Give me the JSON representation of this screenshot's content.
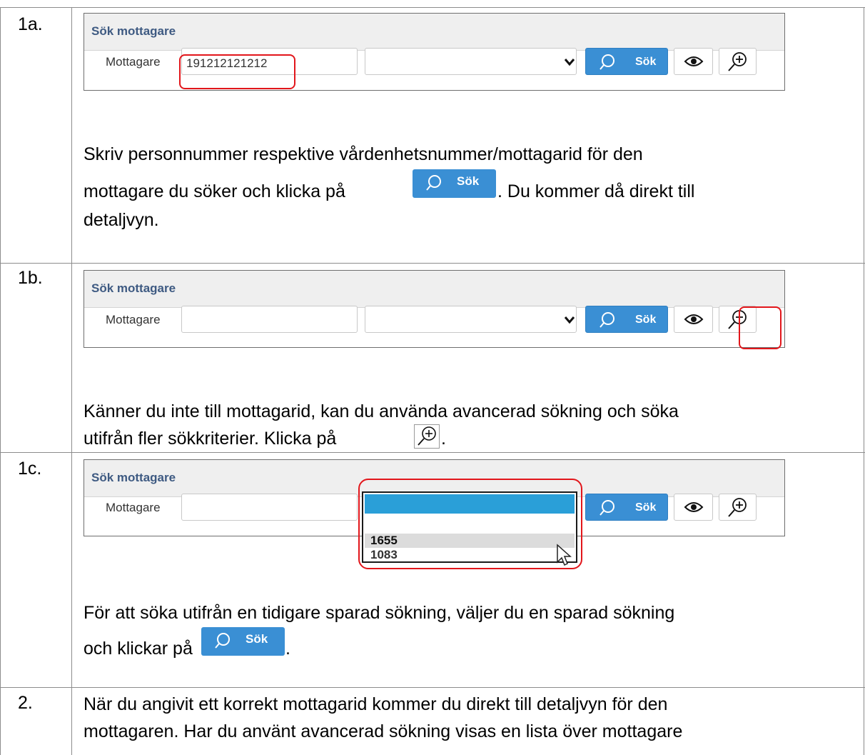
{
  "widget": {
    "title": "Sök mottagare",
    "label": "Mottagare",
    "search_label": "Sök"
  },
  "steps": [
    {
      "num": "1a.",
      "input_value": "191212121212",
      "text_before": "Skriv personnummer respektive vårdenhetsnummer/mottagarid för den",
      "text_line2_before": "mottagare du söker och klicka på",
      "text_line2_after": ". Du kommer då direkt till",
      "text_line3": "detaljvyn."
    },
    {
      "num": "1b.",
      "text_line1": "Känner du inte till mottagarid, kan du använda avancerad sökning och söka",
      "text_line2": "utifrån fler sökkriterier. Klicka på",
      "text_line2_end": "."
    },
    {
      "num": "1c.",
      "dropdown_options": [
        "1655",
        "1083"
      ],
      "text_line1": "För att söka utifrån en tidigare sparad sökning, väljer du en sparad sökning",
      "text_line2_before": "och klickar på",
      "text_line2_after": "."
    },
    {
      "num": "2.",
      "text_line1": "När du angivit ett korrekt mottagarid kommer du direkt till detaljvyn för den",
      "text_line2": "mottagaren. Har du använt avancerad sökning visas en lista över mottagare"
    }
  ],
  "colors": {
    "accent": "#3a8fd4",
    "highlight": "#e2161b",
    "dropdown_selected": "#2a9fd8",
    "title_text": "#3e5a82"
  }
}
